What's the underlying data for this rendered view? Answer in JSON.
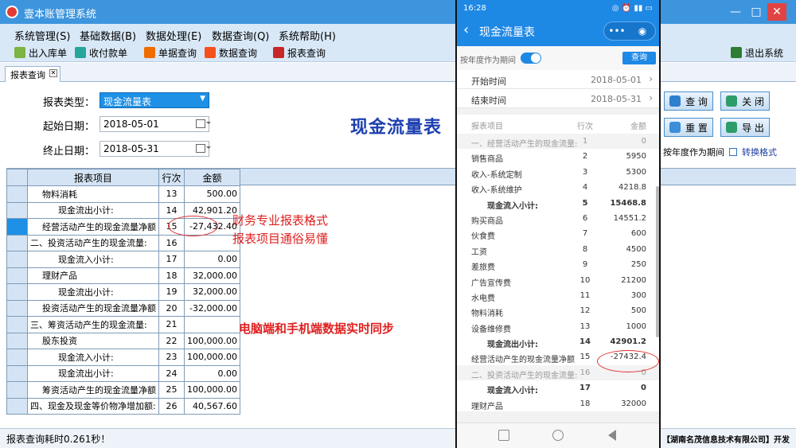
{
  "window": {
    "title": "壹本账管理系统",
    "min": "—",
    "max": "□",
    "close": "✕"
  },
  "menu": [
    "系统管理(S)",
    "基础数据(B)",
    "数据处理(E)",
    "数据查询(Q)",
    "系统帮助(H)"
  ],
  "toolbar": {
    "items": [
      "出入库单",
      "收付款单",
      "单据查询",
      "数据查询",
      "报表查询"
    ],
    "exit": "退出系统"
  },
  "tab": {
    "label": "报表查询",
    "close": "✕"
  },
  "form": {
    "type_label": "报表类型：",
    "type_value": "现金流量表",
    "start_label": "起始日期：",
    "start_value": "2018-05-01",
    "end_label": "终止日期：",
    "end_value": "2018-05-31"
  },
  "report_title": "现金流量表",
  "buttons": {
    "query": "查 询",
    "close": "关 闭",
    "reset": "重 置",
    "export": "导 出"
  },
  "options": {
    "by_year": "按年度作为期间",
    "switch_format": "转换格式"
  },
  "grid": {
    "headers": [
      "报表项目",
      "行次",
      "金额"
    ],
    "rows": [
      {
        "item": "物料消耗",
        "row": "13",
        "amount": "500.00",
        "indent": 1
      },
      {
        "item": "现金流出小计:",
        "row": "14",
        "amount": "42,901.20",
        "indent": 2
      },
      {
        "item": "经营活动产生的现金流量净额",
        "row": "15",
        "amount": "-27,432.40",
        "indent": 1
      },
      {
        "item": "二、投资活动产生的现金流量:",
        "row": "16",
        "amount": "",
        "indent": 0
      },
      {
        "item": "现金流入小计:",
        "row": "17",
        "amount": "0.00",
        "indent": 2
      },
      {
        "item": "理财产品",
        "row": "18",
        "amount": "32,000.00",
        "indent": 1
      },
      {
        "item": "现金流出小计:",
        "row": "19",
        "amount": "32,000.00",
        "indent": 2
      },
      {
        "item": "投资活动产生的现金流量净额",
        "row": "20",
        "amount": "-32,000.00",
        "indent": 1
      },
      {
        "item": "三、筹资活动产生的现金流量:",
        "row": "21",
        "amount": "",
        "indent": 0
      },
      {
        "item": "股东投资",
        "row": "22",
        "amount": "100,000.00",
        "indent": 1
      },
      {
        "item": "现金流入小计:",
        "row": "23",
        "amount": "100,000.00",
        "indent": 2
      },
      {
        "item": "现金流出小计:",
        "row": "24",
        "amount": "0.00",
        "indent": 2
      },
      {
        "item": "筹资活动产生的现金流量净额",
        "row": "25",
        "amount": "100,000.00",
        "indent": 1
      },
      {
        "item": "四、现金及现金等价物净增加额:",
        "row": "26",
        "amount": "40,567.60",
        "indent": 0
      }
    ]
  },
  "annotations": {
    "line1": "财务专业报表格式",
    "line2": "报表项目通俗易懂",
    "line3": "电脑端和手机端数据实时同步"
  },
  "status": {
    "text": "报表查询耗时0.261秒！",
    "developer": "【湖南名茂信息技术有限公司】开发"
  },
  "phone": {
    "time": "16:28",
    "status_icons": "◎ ⏰ ▮▮ ▭",
    "title": "现金流量表",
    "caps_more": "•••",
    "caps_close": "◉",
    "year_toggle_label": "按年度作为期间",
    "query": "查询",
    "start_label": "开始时间",
    "start_value": "2018-05-01",
    "end_label": "结束时间",
    "end_value": "2018-05-31",
    "headers": [
      "报表项目",
      "行次",
      "金额"
    ],
    "rows": [
      {
        "item": "一、经营活动产生的现金流量:",
        "row": "1",
        "amount": "0",
        "kind": "sec"
      },
      {
        "item": "销售商品",
        "row": "2",
        "amount": "5950",
        "kind": ""
      },
      {
        "item": "收入-系统定制",
        "row": "3",
        "amount": "5300",
        "kind": ""
      },
      {
        "item": "收入-系统维护",
        "row": "4",
        "amount": "4218.8",
        "kind": ""
      },
      {
        "item": "现金流入小计:",
        "row": "5",
        "amount": "15468.8",
        "kind": "bold"
      },
      {
        "item": "购买商品",
        "row": "6",
        "amount": "14551.2",
        "kind": ""
      },
      {
        "item": "伙食费",
        "row": "7",
        "amount": "600",
        "kind": ""
      },
      {
        "item": "工资",
        "row": "8",
        "amount": "4500",
        "kind": ""
      },
      {
        "item": "差旅费",
        "row": "9",
        "amount": "250",
        "kind": ""
      },
      {
        "item": "广告宣传费",
        "row": "10",
        "amount": "21200",
        "kind": ""
      },
      {
        "item": "水电费",
        "row": "11",
        "amount": "300",
        "kind": ""
      },
      {
        "item": "物料消耗",
        "row": "12",
        "amount": "500",
        "kind": ""
      },
      {
        "item": "设备维修费",
        "row": "13",
        "amount": "1000",
        "kind": ""
      },
      {
        "item": "现金流出小计:",
        "row": "14",
        "amount": "42901.2",
        "kind": "bold"
      },
      {
        "item": "经营活动产生的现金流量净额",
        "row": "15",
        "amount": "-27432.4",
        "kind": ""
      },
      {
        "item": "二、投资活动产生的现金流量:",
        "row": "16",
        "amount": "0",
        "kind": "sec"
      },
      {
        "item": "现金流入小计:",
        "row": "17",
        "amount": "0",
        "kind": "bold"
      },
      {
        "item": "理财产品",
        "row": "18",
        "amount": "32000",
        "kind": ""
      }
    ]
  },
  "colors": {
    "accent": "#1e88e5",
    "title_blue": "#1d3fb0",
    "annotation_red": "#e02020"
  }
}
